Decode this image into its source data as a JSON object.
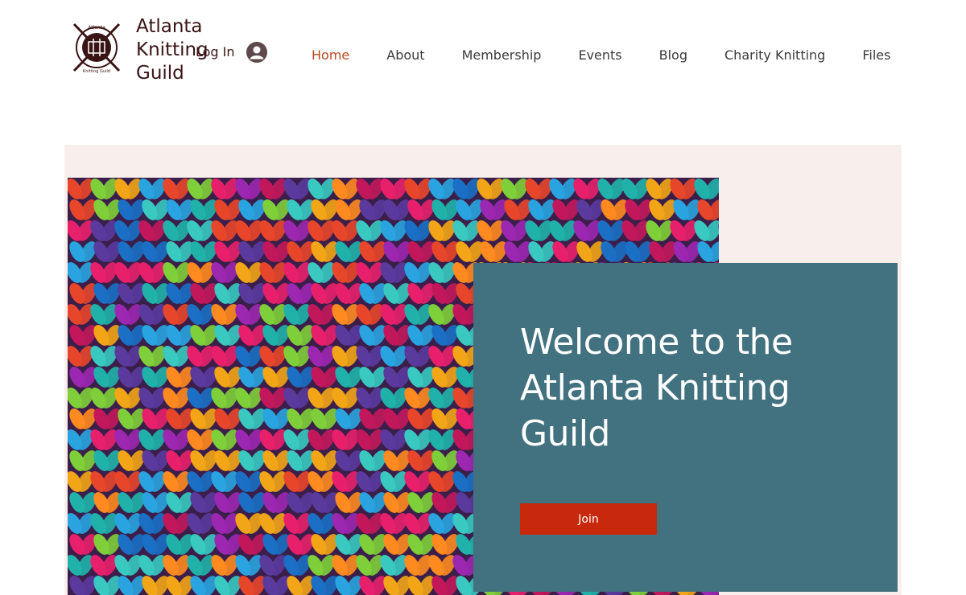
{
  "site": {
    "title": "Atlanta Knitting Guild",
    "logo_icon": "knitting-guild-logo",
    "logo_text_top": "Atlanta",
    "logo_text_bottom": "Knitting Guild",
    "logo_color": "#3a1414"
  },
  "header": {
    "login_label": "Log In",
    "avatar_icon": "user-avatar-icon"
  },
  "nav": {
    "items": [
      {
        "label": "Home",
        "active": true
      },
      {
        "label": "About",
        "active": false
      },
      {
        "label": "Membership",
        "active": false
      },
      {
        "label": "Events",
        "active": false
      },
      {
        "label": "Blog",
        "active": false
      },
      {
        "label": "Charity Knitting",
        "active": false
      },
      {
        "label": "Files",
        "active": false
      }
    ],
    "active_color": "#b9481e"
  },
  "hero": {
    "image": "colorful-knitted-yarn-photo",
    "band_color": "#f8efec",
    "panel_color": "#42717f",
    "title": "Welcome to the Atlanta Knitting Guild",
    "join_label": "Join",
    "join_color": "#c8290c"
  }
}
